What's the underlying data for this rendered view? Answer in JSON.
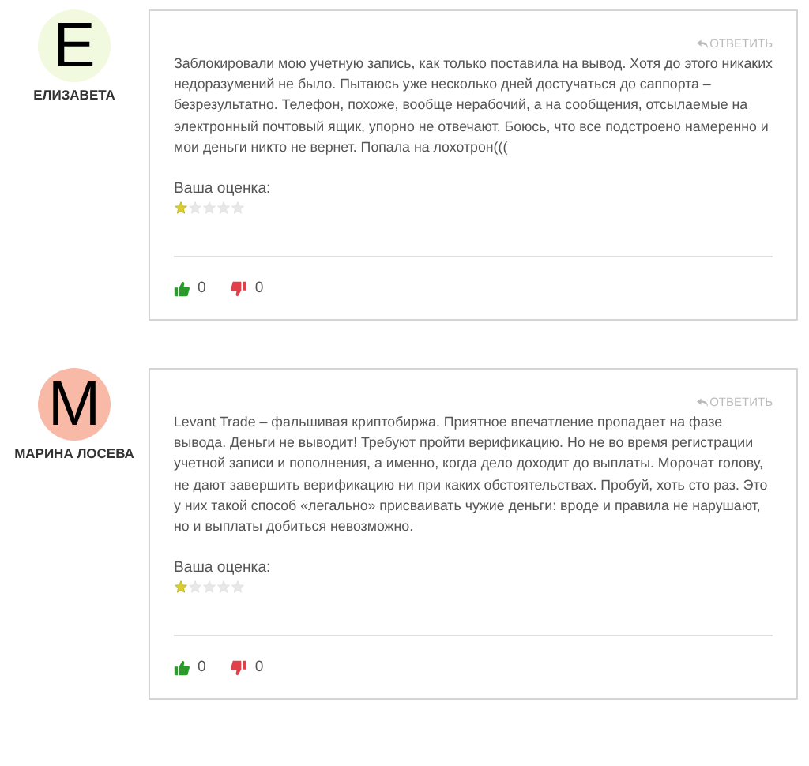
{
  "reviews": [
    {
      "initial": "Е",
      "color": "#f1fadf",
      "author": "ЕЛИЗАВЕТА",
      "reply": "ОТВЕТИТЬ",
      "text": "Заблокировали мою учетную запись, как только поставила на вывод. Хотя до этого никаких недоразумений не было. Пытаюсь уже несколько дней достучаться до саппорта – безрезультатно. Телефон, похоже, вообще нерабочий, а на сообщения, отсылаемые на электронный почтовый ящик, упорно не отвечают. Боюсь, что все подстроено намеренно и мои деньги никто не вернет. Попала на лохотрон(((",
      "rating_label": "Ваша оценка:",
      "stars": 1,
      "likes": "0",
      "dislikes": "0"
    },
    {
      "initial": "М",
      "color": "#f8b9a6",
      "author": "МАРИНА ЛОСЕВА",
      "reply": "ОТВЕТИТЬ",
      "text": "Levant Trade – фальшивая криптобиржа. Приятное впечатление пропадает на фазе вывода. Деньги не выводит! Требуют пройти верификацию. Но не во время регистрации учетной записи и пополнения, а именно, когда дело доходит до выплаты. Морочат голову, не дают завершить верификацию ни при каких обстоятельствах. Пробуй, хоть сто раз. Это у них такой способ «легально» присваивать чужие деньги: вроде и правила не нарушают, но и выплаты добиться невозможно.",
      "rating_label": "Ваша оценка:",
      "stars": 1,
      "likes": "0",
      "dislikes": "0"
    }
  ]
}
